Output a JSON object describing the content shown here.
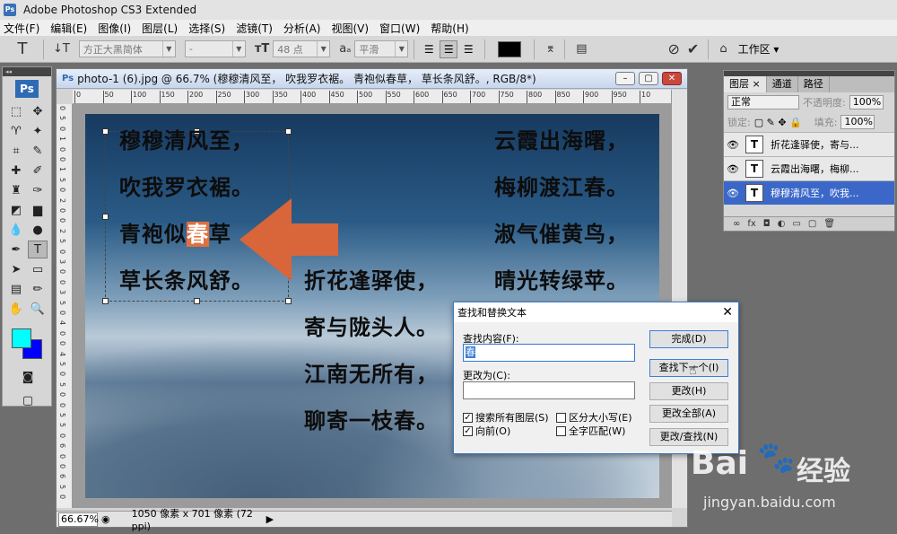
{
  "app": {
    "title": "Adobe Photoshop CS3 Extended",
    "badge": "Ps"
  },
  "menu": [
    "文件(F)",
    "编辑(E)",
    "图像(I)",
    "图层(L)",
    "选择(S)",
    "滤镜(T)",
    "分析(A)",
    "视图(V)",
    "窗口(W)",
    "帮助(H)"
  ],
  "options": {
    "tool_glyph": "T",
    "orient_glyph": "↓T",
    "font_family": "方正大黑简体",
    "font_style": "-",
    "font_size": "48 点",
    "aa_label": "a",
    "antialias": "平滑",
    "text_color": "#000000",
    "workspace": "工作区 ▾"
  },
  "toolbox": {
    "logo": "Ps",
    "foreground": "#00ffff",
    "background": "#0000ff"
  },
  "document": {
    "title": "photo-1 (6).jpg @ 66.7% (穆穆清风至，  吹我罗衣裾。  青袍似春草，  草长条风舒。, RGB/8*)",
    "ruler_h": [
      "0",
      "50",
      "100",
      "150",
      "200",
      "250",
      "300",
      "350",
      "400",
      "450",
      "500",
      "550",
      "600",
      "650",
      "700",
      "750",
      "800",
      "850",
      "900",
      "950",
      "10"
    ],
    "ruler_v": [
      "0",
      "5",
      "0",
      "1",
      "0",
      "0",
      "1",
      "5",
      "0",
      "2",
      "0",
      "0",
      "2",
      "5",
      "0",
      "3",
      "0",
      "0",
      "3",
      "5",
      "0",
      "4",
      "0",
      "0",
      "4",
      "5",
      "0",
      "5",
      "0",
      "0",
      "5",
      "5",
      "0",
      "6",
      "0",
      "0",
      "6",
      "5",
      "0"
    ],
    "poem_left": {
      "line1": "穆穆清风至，",
      "line2": "吹我罗衣裾。",
      "line3_pre": "青袍似",
      "line3_hl": "春",
      "line3_post": "草",
      "line4": "草长条风舒。"
    },
    "poem_mid": [
      "折花逢驿使，",
      "寄与陇头人。",
      "江南无所有，",
      "聊寄一枝春。"
    ],
    "poem_right": [
      "云霞出海曙，",
      "梅柳渡江春。",
      "淑气催黄鸟，",
      "晴光转绿苹。"
    ],
    "zoom": "66.67%",
    "status": "1050 像素 x 701 像素 (72 ppi)"
  },
  "layers_panel": {
    "tabs": [
      "图层 ×",
      "通道",
      "路径"
    ],
    "blend_mode": "正常",
    "opacity_label": "不透明度:",
    "opacity": "100%",
    "lock_label": "锁定:",
    "fill_label": "填充:",
    "fill": "100%",
    "layers": [
      {
        "name": "折花逢驿使，寄与...",
        "thumb": "T",
        "selected": false
      },
      {
        "name": "云霞出海曙，梅柳...",
        "thumb": "T",
        "selected": false
      },
      {
        "name": "穆穆清风至，吹我...",
        "thumb": "T",
        "selected": true
      }
    ]
  },
  "dialog": {
    "title": "查找和替换文本",
    "find_label": "查找内容(F):",
    "find_value": "春",
    "replace_label": "更改为(C):",
    "replace_value": "",
    "buttons": [
      "完成(D)",
      "查找下一个(I)",
      "更改(H)",
      "更改全部(A)",
      "更改/查找(N)"
    ],
    "checks": [
      {
        "label": "搜索所有图层(S)",
        "checked": true
      },
      {
        "label": "区分大小写(E)",
        "checked": false
      },
      {
        "label": "向前(O)",
        "checked": true
      },
      {
        "label": "全字匹配(W)",
        "checked": false
      }
    ]
  },
  "watermark": {
    "brand": "Bai",
    "brand2": "经验",
    "url": "jingyan.baidu.com"
  }
}
